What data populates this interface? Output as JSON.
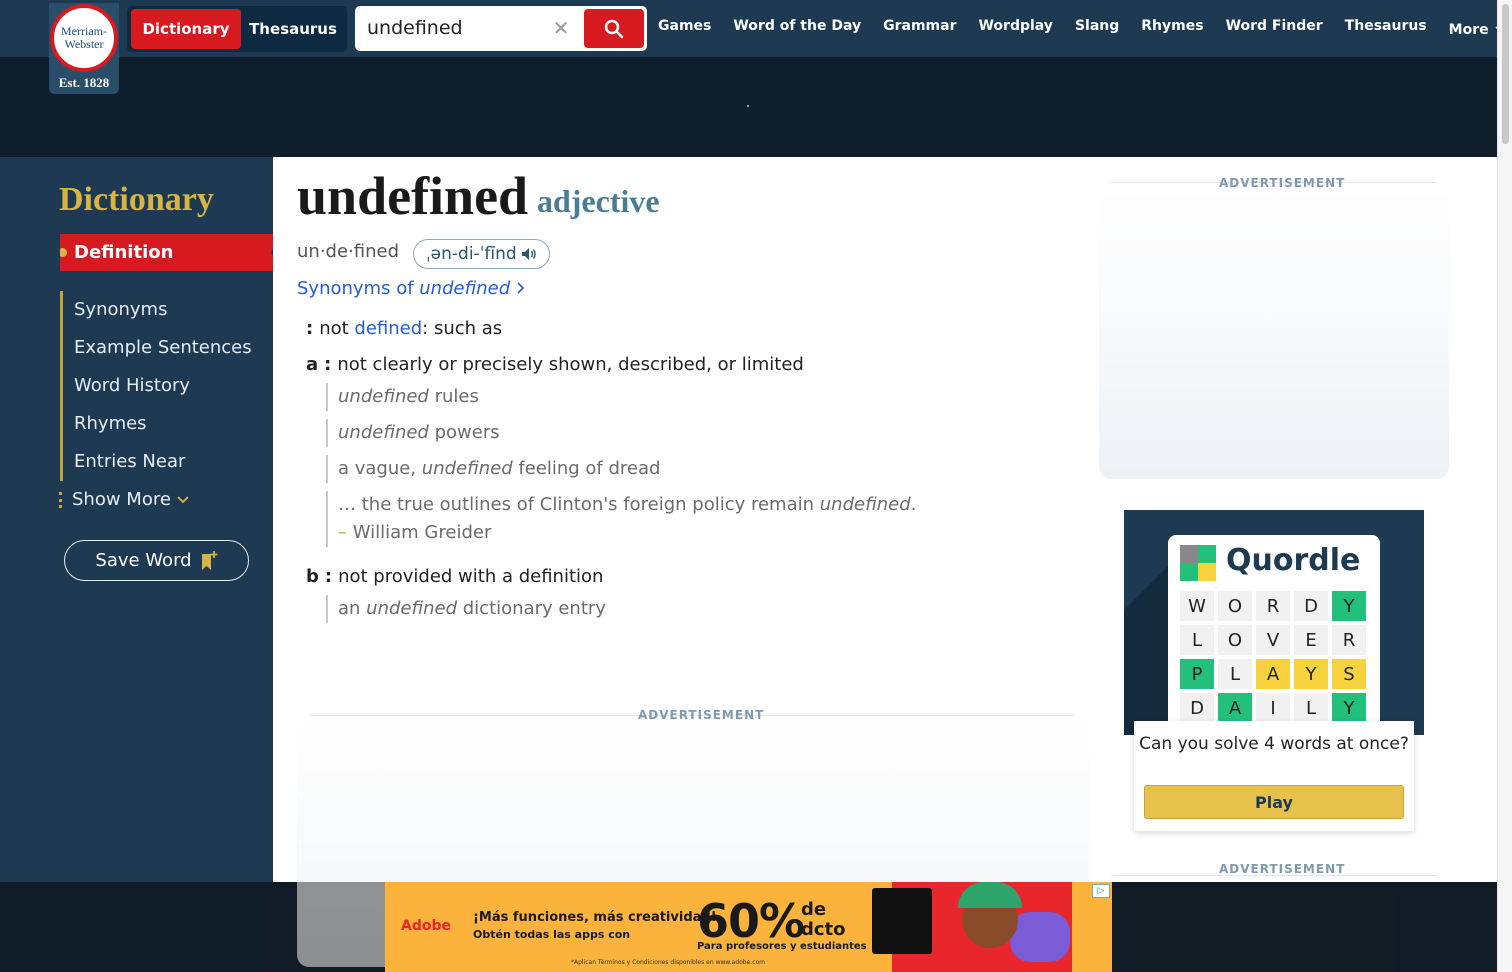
{
  "header": {
    "logo_line1": "Merriam-",
    "logo_line2": "Webster",
    "logo_est": "Est. 1828",
    "tab_dictionary": "Dictionary",
    "tab_thesaurus": "Thesaurus",
    "search_value": "undefined",
    "nav": [
      "Games",
      "Word of the Day",
      "Grammar",
      "Wordplay",
      "Slang",
      "Rhymes",
      "Word Finder",
      "Thesaurus"
    ],
    "nav_more": "More"
  },
  "sidebar": {
    "title": "Dictionary",
    "active": "Definition",
    "items": [
      "Synonyms",
      "Example Sentences",
      "Word History",
      "Rhymes",
      "Entries Near"
    ],
    "show_more": "Show More",
    "save_word": "Save Word"
  },
  "entry": {
    "headword": "undefined",
    "pos": "adjective",
    "syllables": "un·de·fined",
    "pronunciation": "ˌən-di-ˈfīnd",
    "synonyms_prefix": "Synonyms of ",
    "synonyms_word": "undefined",
    "def_main_colon": ":",
    "def_main_pre": "not ",
    "def_main_link": "defined",
    "def_main_post": ": such as",
    "sense_a_label": "a",
    "sense_a_text": "not clearly or precisely shown, described, or limited",
    "ex1_it": "undefined",
    "ex1_rest": " rules",
    "ex2_it": "undefined",
    "ex2_rest": " powers",
    "ex3_pre": "a vague, ",
    "ex3_it": "undefined",
    "ex3_rest": " feeling of dread",
    "ex4_pre": "… the true outlines of Clinton's foreign policy remain ",
    "ex4_it": "undefined",
    "ex4_rest": ".",
    "ex4_dash": "–",
    "ex4_author": "William Greider",
    "sense_b_label": "b",
    "sense_b_text": "not provided with a definition",
    "ex5_pre": "an ",
    "ex5_it": "undefined",
    "ex5_rest": " dictionary entry"
  },
  "ads": {
    "label": "ADVERTISEMENT",
    "quordle_title": "Quordle",
    "quordle_rows": [
      [
        [
          "W",
          ""
        ],
        [
          "O",
          ""
        ],
        [
          "R",
          ""
        ],
        [
          "D",
          ""
        ],
        [
          "Y",
          "g"
        ]
      ],
      [
        [
          "L",
          ""
        ],
        [
          "O",
          ""
        ],
        [
          "V",
          ""
        ],
        [
          "E",
          ""
        ],
        [
          "R",
          ""
        ]
      ],
      [
        [
          "P",
          "g"
        ],
        [
          "L",
          ""
        ],
        [
          "A",
          "y"
        ],
        [
          "Y",
          "y"
        ],
        [
          "S",
          "y"
        ]
      ],
      [
        [
          "D",
          ""
        ],
        [
          "A",
          "g"
        ],
        [
          "I",
          ""
        ],
        [
          "L",
          ""
        ],
        [
          "Y",
          "g"
        ]
      ]
    ],
    "quordle_question": "Can you solve 4 words at once?",
    "quordle_play": "Play",
    "adobe_brand": "Adobe",
    "adobe_h1": "¡Más funciones, más creatividad!",
    "adobe_h2": "Obtén todas las apps con",
    "adobe_pct": "60%",
    "adobe_de": "de",
    "adobe_dcto": "dcto",
    "adobe_sub": "Para profesores y estudiantes",
    "adobe_fine": "*Aplican Términos y Condiciones disponibles en www.adobe.com"
  },
  "colors": {
    "brand_red": "#d71920",
    "nav_blue": "#1d3a52",
    "gold": "#d9b343",
    "link_blue": "#265bd6"
  }
}
